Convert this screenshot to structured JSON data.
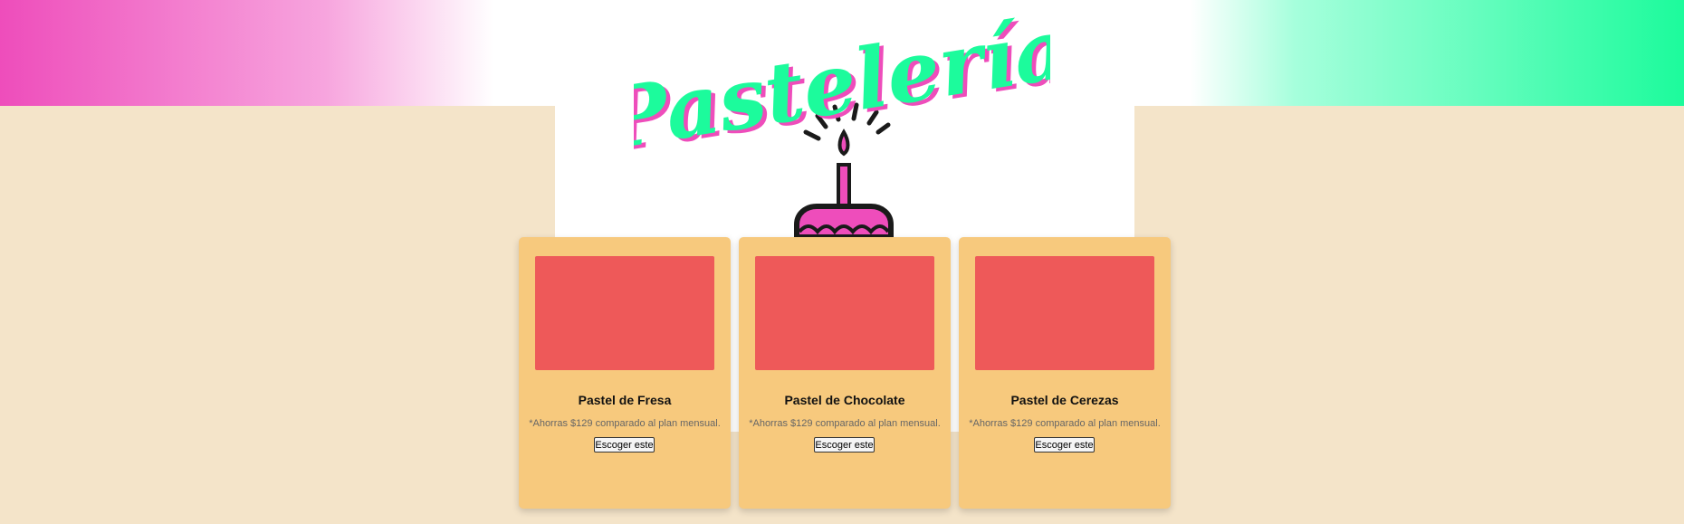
{
  "header": {
    "logo_text": "Pastelería",
    "colors": {
      "pink": "#ee4dbb",
      "mint": "#1cfb9c",
      "cream": "#f4e4c9",
      "card": "#f7c97d",
      "image_placeholder": "#ee5959"
    }
  },
  "cards": [
    {
      "title": "Pastel de Fresa",
      "note": "*Ahorras $129 comparado al plan mensual.",
      "button_label": "Escoger este"
    },
    {
      "title": "Pastel de Chocolate",
      "note": "*Ahorras $129 comparado al plan mensual.",
      "button_label": "Escoger este"
    },
    {
      "title": "Pastel de Cerezas",
      "note": "*Ahorras $129 comparado al plan mensual.",
      "button_label": "Escoger este"
    }
  ],
  "icons": [
    "cake-icon",
    "candle-icon",
    "sparkle-icon"
  ]
}
